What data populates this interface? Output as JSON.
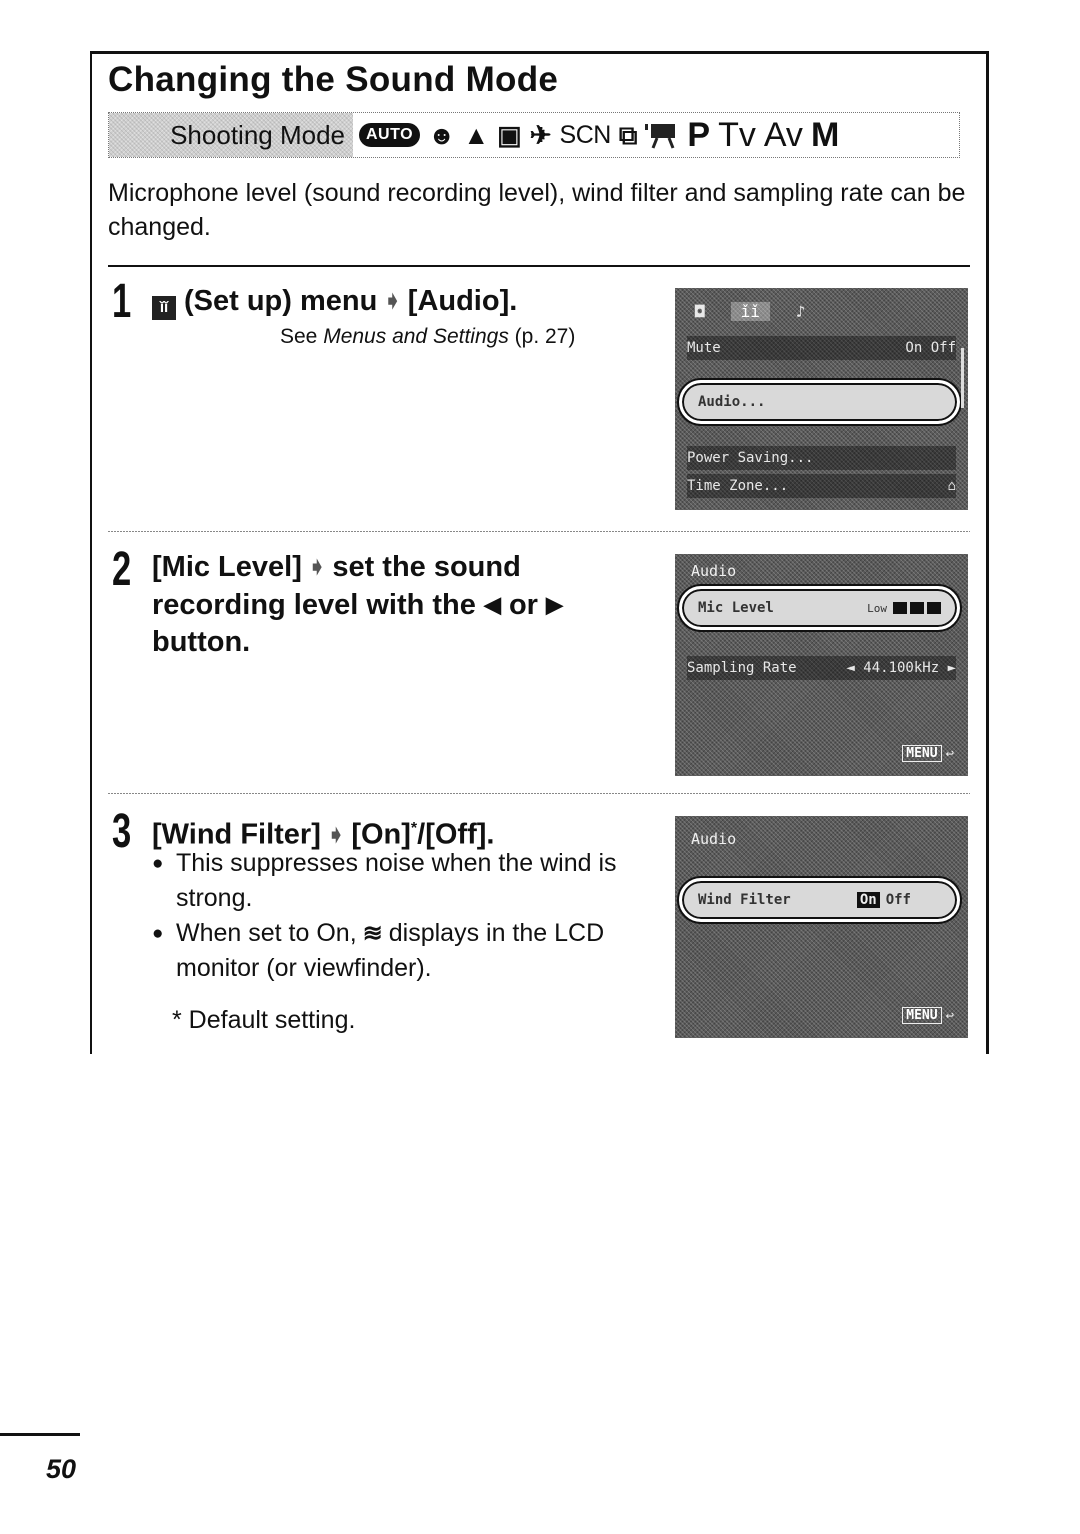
{
  "section": {
    "title": "Changing the Sound Mode",
    "shooting_mode": {
      "label": "Shooting Mode",
      "modes": [
        {
          "name": "auto-mode-icon",
          "glyph": "AUTO"
        },
        {
          "name": "portrait-mode-icon",
          "glyph": "☻"
        },
        {
          "name": "landscape-mode-icon",
          "glyph": "▲"
        },
        {
          "name": "night-scene-mode-icon",
          "glyph": "▣"
        },
        {
          "name": "sports-mode-icon",
          "glyph": "✈"
        },
        {
          "name": "scene-mode-icon",
          "glyph": "SCN"
        },
        {
          "name": "stitch-assist-mode-icon",
          "glyph": "⧉"
        },
        {
          "name": "movie-mode-icon",
          "glyph": "🎥"
        },
        {
          "name": "program-mode-icon",
          "glyph": "P"
        },
        {
          "name": "shutter-priority-mode-icon",
          "glyph": "Tv"
        },
        {
          "name": "aperture-priority-mode-icon",
          "glyph": "Av"
        },
        {
          "name": "manual-mode-icon",
          "glyph": "M"
        }
      ]
    },
    "intro": "Microphone level (sound recording level), wind filter and sampling rate can be changed."
  },
  "steps": [
    {
      "number": "1",
      "icon_glyph": "ǐǐ",
      "pre": "(Set up) menu",
      "arrow": "➧",
      "post": "[Audio].",
      "see_prefix": "See ",
      "see_italic": "Menus and Settings",
      "see_suffix": " (p. 27)",
      "screen": {
        "tabs": [
          "◘",
          "ǐǐ",
          "♪"
        ],
        "rows": [
          {
            "label": "Mute",
            "value": "On  Off"
          },
          {
            "label": "Audio...",
            "value": "",
            "highlighted": true
          },
          {
            "label": "Power Saving...",
            "value": ""
          },
          {
            "label": "Time Zone...",
            "value": "⌂"
          }
        ]
      }
    },
    {
      "number": "2",
      "line1_pre": "[Mic Level]",
      "arrow": "➧",
      "line1_post": "set the sound",
      "line2_pre": "recording level with the",
      "left_tri": "◀",
      "or": "or",
      "right_tri": "▶",
      "line3": "button.",
      "screen": {
        "header": "Audio",
        "rows": [
          {
            "label": "Mic Level",
            "value": "Low",
            "level": 3,
            "highlighted": true
          },
          {
            "label": "Sampling Rate",
            "value": "◄ 44.100kHz ►"
          }
        ],
        "menu_label": "MENU",
        "return_glyph": "↩"
      }
    },
    {
      "number": "3",
      "pre": "[Wind Filter]",
      "arrow": "➧",
      "post_a": "[On]",
      "star": "*",
      "post_b": "/[Off].",
      "bullets": [
        {
          "text": "This suppresses noise when the wind is strong."
        },
        {
          "pre": "When set to On,",
          "icon_glyph": "≋",
          "post": "displays in the LCD monitor (or viewfinder)."
        }
      ],
      "footnote": "* Default setting.",
      "screen": {
        "header": "Audio",
        "rows": [
          {
            "label": "Wind Filter",
            "on": "On",
            "off": "Off",
            "highlighted": true
          }
        ],
        "menu_label": "MENU",
        "return_glyph": "↩"
      }
    }
  ],
  "page_number": "50"
}
